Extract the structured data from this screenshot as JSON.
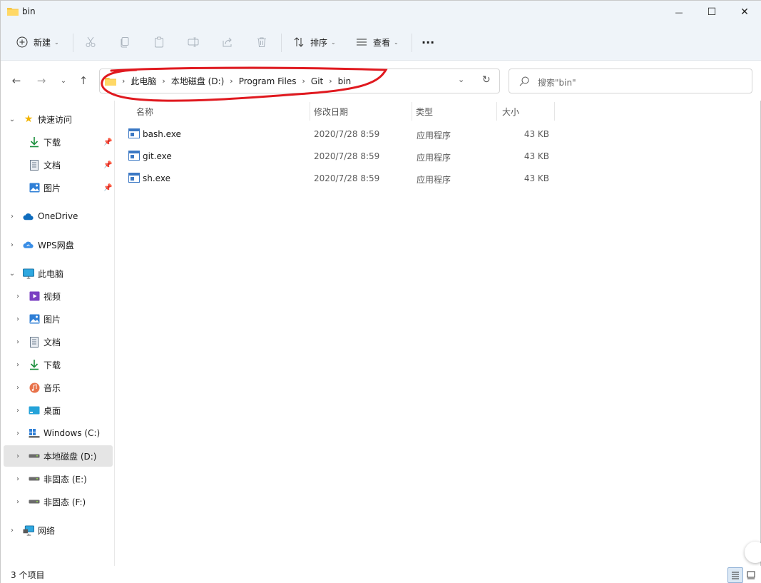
{
  "window": {
    "title": "bin",
    "minimize_glyph": "—",
    "maximize_glyph": "☐",
    "close_glyph": "✕"
  },
  "toolbar": {
    "new_label": "新建",
    "sort_label": "排序",
    "view_label": "查看",
    "more_glyph": "···"
  },
  "address": {
    "crumbs": [
      "此电脑",
      "本地磁盘 (D:)",
      "Program Files",
      "Git",
      "bin"
    ]
  },
  "search": {
    "placeholder": "搜索\"bin\""
  },
  "sidebar": {
    "quick_access": {
      "label": "快速访问",
      "items": [
        {
          "label": "下载"
        },
        {
          "label": "文档"
        },
        {
          "label": "图片"
        }
      ]
    },
    "onedrive": "OneDrive",
    "wps": "WPS网盘",
    "this_pc": {
      "label": "此电脑",
      "items": [
        {
          "label": "视频"
        },
        {
          "label": "图片"
        },
        {
          "label": "文档"
        },
        {
          "label": "下载"
        },
        {
          "label": "音乐"
        },
        {
          "label": "桌面"
        },
        {
          "label": "Windows (C:)"
        },
        {
          "label": "本地磁盘 (D:)"
        },
        {
          "label": "非固态 (E:)"
        },
        {
          "label": "非固态 (F:)"
        }
      ]
    },
    "network": "网络"
  },
  "columns": {
    "name": "名称",
    "modified": "修改日期",
    "type": "类型",
    "size": "大小"
  },
  "files": [
    {
      "name": "bash.exe",
      "modified": "2020/7/28 8:59",
      "type": "应用程序",
      "size": "43 KB"
    },
    {
      "name": "git.exe",
      "modified": "2020/7/28 8:59",
      "type": "应用程序",
      "size": "43 KB"
    },
    {
      "name": "sh.exe",
      "modified": "2020/7/28 8:59",
      "type": "应用程序",
      "size": "43 KB"
    }
  ],
  "status": {
    "item_count": "3 个项目"
  },
  "colors": {
    "annotation": "#e0191f",
    "chrome_bg": "#eff4f9",
    "accent": "#0067c0"
  }
}
